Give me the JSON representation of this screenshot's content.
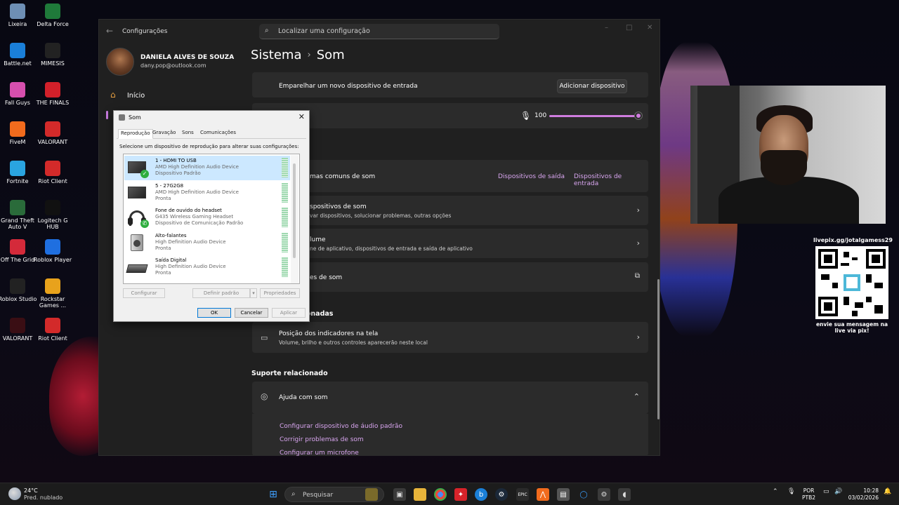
{
  "desktop": {
    "icons": [
      {
        "label": "Lixeira",
        "color": "#6e8fb5"
      },
      {
        "label": "Delta Force",
        "color": "#1f7a3a"
      },
      {
        "label": "Battle.net",
        "color": "#1a7fd8"
      },
      {
        "label": "MIMESIS",
        "color": "#222222"
      },
      {
        "label": "Fall Guys",
        "color": "#d64fae"
      },
      {
        "label": "THE FINALS",
        "color": "#d2202a"
      },
      {
        "label": "FiveM",
        "color": "#f26b1d"
      },
      {
        "label": "VALORANT",
        "color": "#d32a2a"
      },
      {
        "label": "Fortnite",
        "color": "#2aa4e0"
      },
      {
        "label": "Riot Client",
        "color": "#d32a2a"
      },
      {
        "label": "Grand Theft Auto V",
        "color": "#2a6b3a"
      },
      {
        "label": "Logitech G HUB",
        "color": "#111111"
      },
      {
        "label": "Off The Grid",
        "color": "#d42a3a"
      },
      {
        "label": "Roblox Player",
        "color": "#1f6fe0"
      },
      {
        "label": "Roblox Studio",
        "color": "#222222"
      },
      {
        "label": "Rockstar Games ...",
        "color": "#e8a21c"
      },
      {
        "label": "VALORANT",
        "color": "#3a0e14"
      },
      {
        "label": "Riot Client",
        "color": "#d32a2a"
      }
    ]
  },
  "settings": {
    "app_title": "Configurações",
    "search_placeholder": "Localizar uma configuração",
    "user_name": "DANIELA ALVES DE SOUZA",
    "user_email": "dany.pop@outlook.com",
    "nav_home": "Início",
    "breadcrumb_parent": "Sistema",
    "breadcrumb_sep": "›",
    "breadcrumb_current": "Som",
    "pair_input_label": "Emparelhar um novo dispositivo de entrada",
    "add_device_label": "Adicionar dispositivo",
    "volume_value": "100",
    "volume_level": 1.0,
    "troubleshoot_label": "mas comuns de som",
    "output_devices_link": "Dispositivos de saída",
    "input_devices_link": "Dispositivos de entrada",
    "all_devices_title": "spositivos de som",
    "all_devices_desc": "var dispositivos, solucionar problemas, outras opções",
    "mixer_title": "lume",
    "mixer_desc": "ne de aplicativo, dispositivos de entrada e saída de aplicativo",
    "more_settings_title": "es de som",
    "related_section_title": "cionadas",
    "indicators_title": "Posição dos indicadores na tela",
    "indicators_desc": "Volume, brilho e outros controles aparecerão neste local",
    "support_section_title": "Suporte relacionado",
    "help_title": "Ajuda com som",
    "help_links": [
      "Configurar dispositivo de áudio padrão",
      "Corrigir problemas de som",
      "Configurar um microfone"
    ]
  },
  "sound_dialog": {
    "title": "Som",
    "tabs": [
      "Reprodução",
      "Gravação",
      "Sons",
      "Comunicações"
    ],
    "instruction": "Selecione um dispositivo de reprodução para alterar suas configurações:",
    "devices": [
      {
        "name": "1 - HDMI TO USB",
        "driver": "AMD High Definition Audio Device",
        "status": "Dispositivo Padrão",
        "icon": "monitor-icon",
        "badge": "check"
      },
      {
        "name": "5 - 27G2G8",
        "driver": "AMD High Definition Audio Device",
        "status": "Pronta",
        "icon": "monitor-icon",
        "badge": ""
      },
      {
        "name": "Fone de ouvido do headset",
        "driver": "G435 Wireless Gaming Headset",
        "status": "Dispositivo de Comunicação Padrão",
        "icon": "headset-icon",
        "badge": "phone"
      },
      {
        "name": "Alto-falantes",
        "driver": "High Definition Audio Device",
        "status": "Pronta",
        "icon": "speaker-icon",
        "badge": ""
      },
      {
        "name": "Saída Digital",
        "driver": "High Definition Audio Device",
        "status": "Pronta",
        "icon": "digital-output-icon",
        "badge": ""
      }
    ],
    "btn_configure": "Configurar",
    "btn_set_default": "Definir padrão",
    "btn_properties": "Propriedades",
    "btn_ok": "OK",
    "btn_cancel": "Cancelar",
    "btn_apply": "Aplicar"
  },
  "overlay": {
    "qr_caption_top": "livepix.gg/jotalgamess29",
    "qr_caption_bottom": "envie sua mensagem na live via pix!"
  },
  "taskbar": {
    "temperature": "24°C",
    "weather": "Pred. nublado",
    "search_label": "Pesquisar",
    "lang_line1": "POR",
    "lang_line2": "PTB2",
    "time": "10:28",
    "date": "03/02/2026"
  }
}
